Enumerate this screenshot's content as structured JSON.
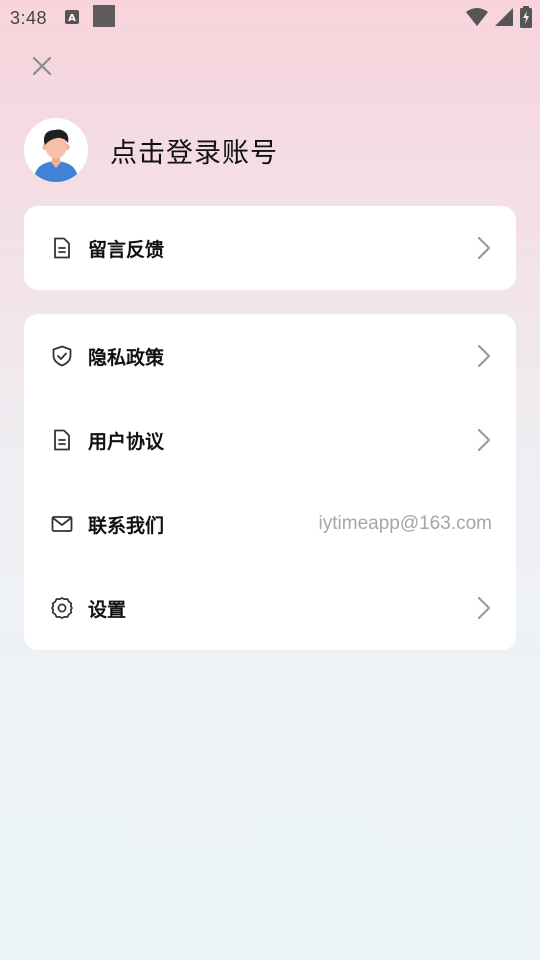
{
  "status_bar": {
    "time": "3:48",
    "icons": [
      "keyboard-notification-icon",
      "app-notification-icon",
      "wifi-icon",
      "signal-icon",
      "battery-charging-icon"
    ]
  },
  "header": {
    "close_icon": "close-icon"
  },
  "profile": {
    "avatar_icon": "user-avatar",
    "login_text": "点击登录账号"
  },
  "menu": {
    "feedback": {
      "label": "留言反馈",
      "icon": "document-icon"
    },
    "privacy": {
      "label": "隐私政策",
      "icon": "shield-check-icon"
    },
    "agreement": {
      "label": "用户协议",
      "icon": "document-icon"
    },
    "contact": {
      "label": "联系我们",
      "icon": "mail-icon",
      "value": "iytimeapp@163.com"
    },
    "settings": {
      "label": "设置",
      "icon": "gear-icon"
    }
  },
  "colors": {
    "gradient_top": "#f8d3dc",
    "gradient_bottom": "#ecf4f8",
    "card": "#ffffff",
    "text_primary": "#111111",
    "text_secondary": "#a6a6a6",
    "chevron": "#9a9a9a"
  }
}
